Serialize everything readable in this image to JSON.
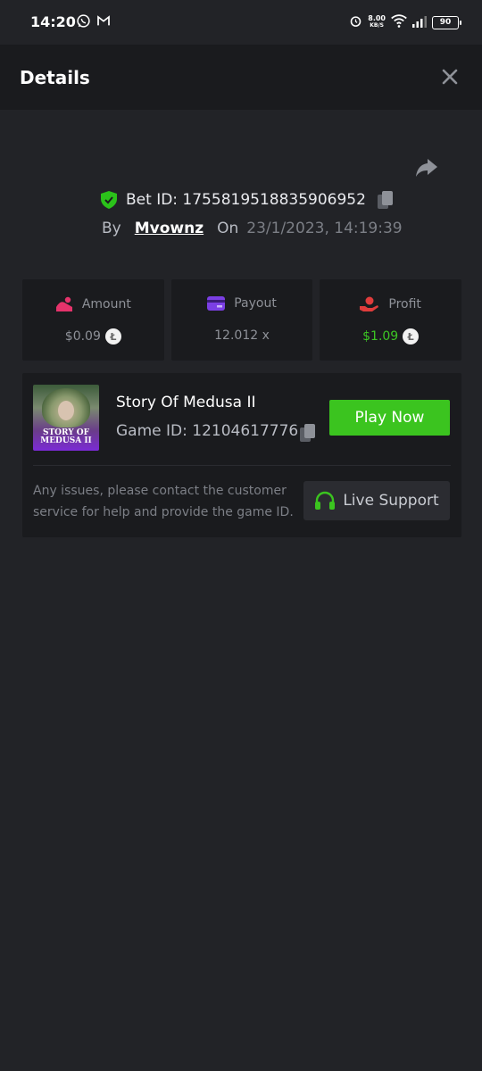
{
  "status_bar": {
    "time": "14:20",
    "network_speed": "8.00",
    "network_unit": "KB/S",
    "battery": "90"
  },
  "header": {
    "title": "Details"
  },
  "bet": {
    "id_label": "Bet ID: 1755819518835906952",
    "by_label": "By",
    "username": "Mvownz",
    "on_label": "On",
    "datetime": "23/1/2023, 14:19:39"
  },
  "stats": {
    "amount": {
      "label": "Amount",
      "value": "$0.09"
    },
    "payout": {
      "label": "Payout",
      "value": "12.012 x"
    },
    "profit": {
      "label": "Profit",
      "value": "$1.09"
    }
  },
  "game": {
    "title": "Story Of Medusa II",
    "id_label": "Game ID: 12104617776",
    "thumb_line1": "STORY OF",
    "thumb_line2": "MEDUSA II",
    "play_label": "Play Now",
    "help_text": "Any issues, please contact the customer service for help and provide the game ID.",
    "support_label": "Live Support"
  },
  "colors": {
    "background": "#222327",
    "panel": "#1a1b1e",
    "accent_green": "#3bc41f",
    "profit_green": "#3cc524",
    "amount_pink": "#e5336b",
    "payout_purple": "#7b3fe4",
    "profit_red": "#e03c3c"
  },
  "icons": {
    "whatsapp": "whatsapp-icon",
    "gmail": "gmail-icon",
    "alarm": "alarm-icon",
    "wifi": "wifi-icon",
    "signal": "signal-icon",
    "close": "close-icon",
    "share": "share-icon",
    "shield": "shield-check-icon",
    "copy": "copy-icon",
    "coin": "litecoin-icon",
    "headset": "headset-icon"
  }
}
